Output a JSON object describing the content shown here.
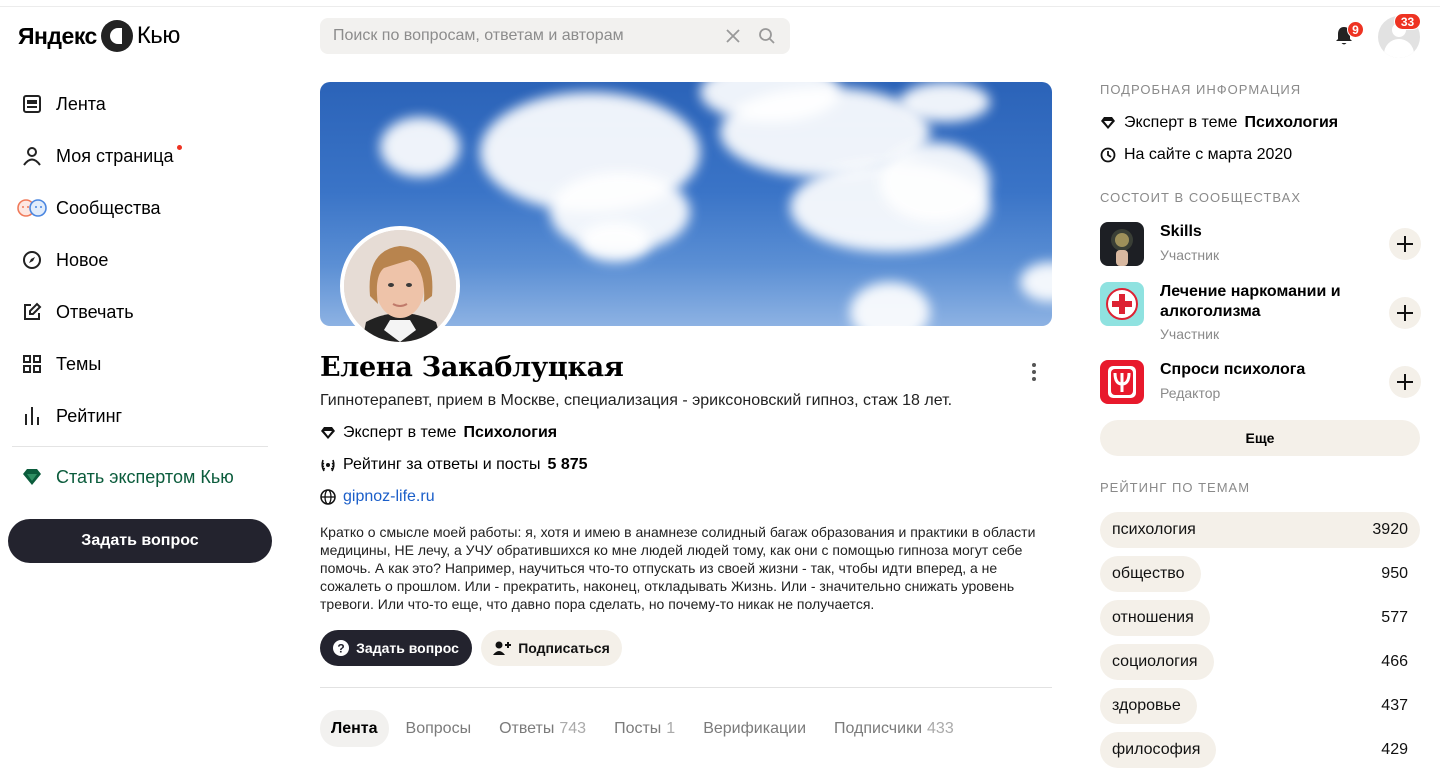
{
  "header": {
    "logo_brand": "Яндекс",
    "logo_product": "Кью",
    "search_placeholder": "Поиск по вопросам, ответам и авторам",
    "notifications_count": "9",
    "profile_count": "33"
  },
  "nav": {
    "items": [
      {
        "label": "Лента",
        "icon": "feed-icon"
      },
      {
        "label": "Моя страница",
        "icon": "person-icon",
        "dot": true
      },
      {
        "label": "Сообщества",
        "icon": "communities-icon"
      },
      {
        "label": "Новое",
        "icon": "compass-icon"
      },
      {
        "label": "Отвечать",
        "icon": "edit-icon"
      },
      {
        "label": "Темы",
        "icon": "grid-icon"
      },
      {
        "label": "Рейтинг",
        "icon": "bars-icon"
      }
    ],
    "expert_label": "Стать экспертом Кью",
    "ask_button": "Задать вопрос"
  },
  "profile": {
    "name": "Елена Закаблуцкая",
    "tagline": "Гипнотерапевт, прием в Москве, специализация - эриксоновский гипноз, стаж 18 лет.",
    "expert_label": "Эксперт в теме",
    "expert_topic": "Психология",
    "rating_label": "Рейтинг за ответы и посты",
    "rating_value": "5 875",
    "website": "gipnoz-life.ru",
    "about": "Кратко о смысле моей работы: я, хотя и имею в анамнезе солидный багаж образования и практики в области медицины, НЕ лечу, а УЧУ обратившихся ко мне людей людей тому, как они с помощью гипноза могут себе помочь. А как это? Например, научиться что-то отпускать из своей жизни - так, чтобы идти вперед, а не сожалеть о прошлом. Или - прекратить, наконец, откладывать Жизнь. Или - значительно снижать уровень тревоги. Или что-то еще, что давно пора сделать, но почему-то никак не получается.",
    "ask_button": "Задать вопрос",
    "subscribe_button": "Подписаться"
  },
  "tabs": [
    {
      "label": "Лента",
      "count": "",
      "active": true
    },
    {
      "label": "Вопросы",
      "count": ""
    },
    {
      "label": "Ответы",
      "count": "743"
    },
    {
      "label": "Посты",
      "count": "1"
    },
    {
      "label": "Верификации",
      "count": ""
    },
    {
      "label": "Подписчики",
      "count": "433"
    }
  ],
  "sidebar": {
    "details_heading": "Подробная информация",
    "expert_label": "Эксперт в теме",
    "expert_topic": "Психология",
    "since_label": "На сайте с марта 2020",
    "communities_heading": "Состоит в сообществах",
    "communities": [
      {
        "name": "Skills",
        "role": "Участник"
      },
      {
        "name": "Лечение наркомании и алкоголизма",
        "role": "Участник"
      },
      {
        "name": "Спроси психолога",
        "role": "Редактор"
      }
    ],
    "more_button": "Еще",
    "rating_heading": "Рейтинг по темам",
    "ratings": [
      {
        "topic": "психология",
        "score": "3920",
        "value": 3920
      },
      {
        "topic": "общество",
        "score": "950",
        "value": 950
      },
      {
        "topic": "отношения",
        "score": "577",
        "value": 577
      },
      {
        "topic": "социология",
        "score": "466",
        "value": 466
      },
      {
        "topic": "здоровье",
        "score": "437",
        "value": 437
      },
      {
        "topic": "философия",
        "score": "429",
        "value": 429
      }
    ]
  }
}
